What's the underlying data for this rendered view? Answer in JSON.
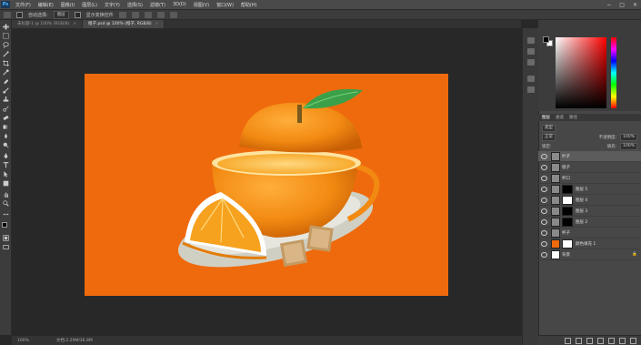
{
  "menubar": {
    "logo": "Ps",
    "items": [
      "文件(F)",
      "编辑(E)",
      "图像(I)",
      "图层(L)",
      "文字(Y)",
      "选择(S)",
      "滤镜(T)",
      "3D(D)",
      "视图(V)",
      "窗口(W)",
      "帮助(H)"
    ],
    "window_controls": [
      "−",
      "□",
      "✕"
    ]
  },
  "options": {
    "auto_select_label": "自动选择:",
    "auto_select_value": "图层",
    "show_transform_label": "显示变换控件"
  },
  "tabs": [
    {
      "label": "未标题-1 @ 100% (RGB/8)",
      "close": "×",
      "active": false
    },
    {
      "label": "橙子.psd @ 100% (橙子, RGB/8)",
      "close": "×",
      "active": true
    }
  ],
  "status": {
    "zoom": "100%",
    "doc_info": "文档:2.29M/36.8M"
  },
  "layers_panel": {
    "tabs": [
      {
        "label": "图层",
        "active": true
      },
      {
        "label": "通道",
        "active": false
      },
      {
        "label": "路径",
        "active": false
      }
    ],
    "kind_filter": "类型",
    "blend_mode": "正常",
    "opacity_label": "不透明度:",
    "opacity_value": "100%",
    "lock_label": "锁定:",
    "fill_label": "填充:",
    "fill_value": "100%",
    "layers": [
      {
        "name": "叶子",
        "thumb": "grey",
        "mask": "",
        "selected": true,
        "locked": false
      },
      {
        "name": "橙子",
        "thumb": "grey",
        "mask": "",
        "selected": false,
        "locked": false
      },
      {
        "name": "杯口",
        "thumb": "grey",
        "mask": "",
        "selected": false,
        "locked": false
      },
      {
        "name": "图层 5",
        "thumb": "grey",
        "mask": "black",
        "selected": false,
        "locked": false
      },
      {
        "name": "图层 4",
        "thumb": "grey",
        "mask": "white",
        "selected": false,
        "locked": false
      },
      {
        "name": "图层 3",
        "thumb": "grey",
        "mask": "black",
        "selected": false,
        "locked": false
      },
      {
        "name": "图层 2",
        "thumb": "grey",
        "mask": "black",
        "selected": false,
        "locked": false
      },
      {
        "name": "杯子",
        "thumb": "grey",
        "mask": "",
        "selected": false,
        "locked": false
      },
      {
        "name": "颜色填充 1",
        "thumb": "orange",
        "mask": "white",
        "selected": false,
        "locked": false
      },
      {
        "name": "背景",
        "thumb": "white",
        "mask": "",
        "selected": false,
        "locked": true
      }
    ]
  },
  "colors": {
    "canvas": "#ef6a0d",
    "foreground": "#000000",
    "background": "#ffffff"
  },
  "icons": {
    "tools": [
      "move-icon",
      "marquee-icon",
      "lasso-icon",
      "quick-select-icon",
      "crop-icon",
      "eyedropper-icon",
      "healing-brush-icon",
      "brush-icon",
      "clone-stamp-icon",
      "history-brush-icon",
      "eraser-icon",
      "gradient-icon",
      "blur-icon",
      "dodge-icon",
      "pen-icon",
      "type-icon",
      "path-select-icon",
      "shape-icon",
      "hand-icon",
      "zoom-icon"
    ],
    "lock": "lock-icon"
  }
}
